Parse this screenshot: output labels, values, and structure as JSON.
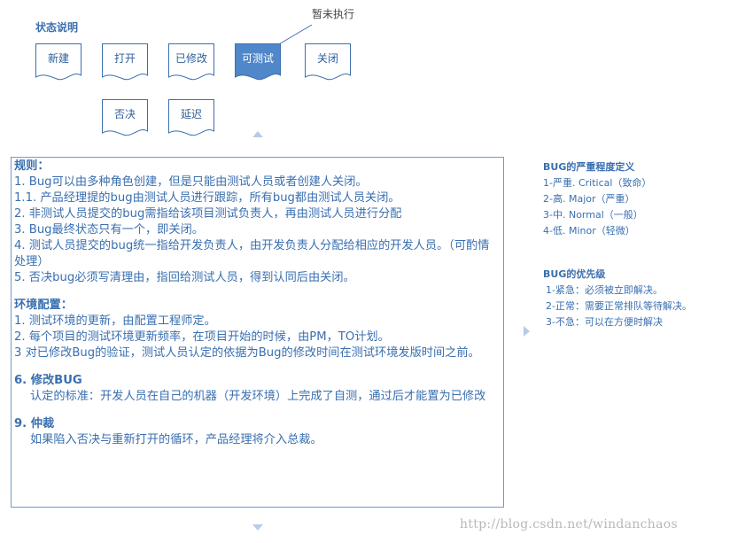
{
  "status": {
    "title": "状态说明",
    "callout": "暂未执行",
    "nodes": [
      "新建",
      "打开",
      "已修改",
      "可测试",
      "关闭",
      "否决",
      "延迟"
    ]
  },
  "rules": {
    "heading": "规则：",
    "lines": [
      "1. Bug可以由多种角色创建，但是只能由测试人员或者创建人关闭。",
      "1.1. 产品经理提的bug由测试人员进行跟踪，所有bug都由测试人员关闭。",
      "2. 非测试人员提交的bug需指给该项目测试负责人，再由测试人员进行分配",
      "3. Bug最终状态只有一个，即关闭。",
      "4. 测试人员提交的bug统一指给开发负责人，由开发负责人分配给相应的开发人员。（可酌情处理）",
      "5. 否决bug必须写清理由，指回给测试人员，得到认同后由关闭。"
    ],
    "env_heading": "环境配置：",
    "env_lines": [
      "1. 测试环境的更新，由配置工程师定。",
      "2. 每个项目的测试环境更新频率，在项目开始的时候，由PM，TO计划。",
      "3  对已修改Bug的验证，测试人员认定的依据为Bug的修改时间在测试环境发版时间之前。"
    ],
    "fix_heading": "6. 修改BUG",
    "fix_text": "认定的标准：开发人员在自己的机器（开发环境）上完成了自测，通过后才能置为已修改",
    "arb_heading": "9. 仲裁",
    "arb_text": "如果陷入否决与重新打开的循环，产品经理将介入总裁。"
  },
  "severity": {
    "title": "BUG的严重程度定义",
    "items": [
      "1-严重. Critical（致命）",
      "2-高. Major（严重）",
      "3-中. Normal（一般）",
      "4-低. Minor（轻微）"
    ]
  },
  "priority": {
    "title": "BUG的优先级",
    "items": [
      "1-紧急：必须被立即解决。",
      "2-正常：需要正常排队等待解决。",
      "3-不急：可以在方便时解决"
    ]
  },
  "watermark": "http://blog.csdn.net/windanchaos",
  "colors": {
    "accent": "#3a6fb0",
    "active_fill": "#4f87c9",
    "border": "#6f9bd1"
  }
}
